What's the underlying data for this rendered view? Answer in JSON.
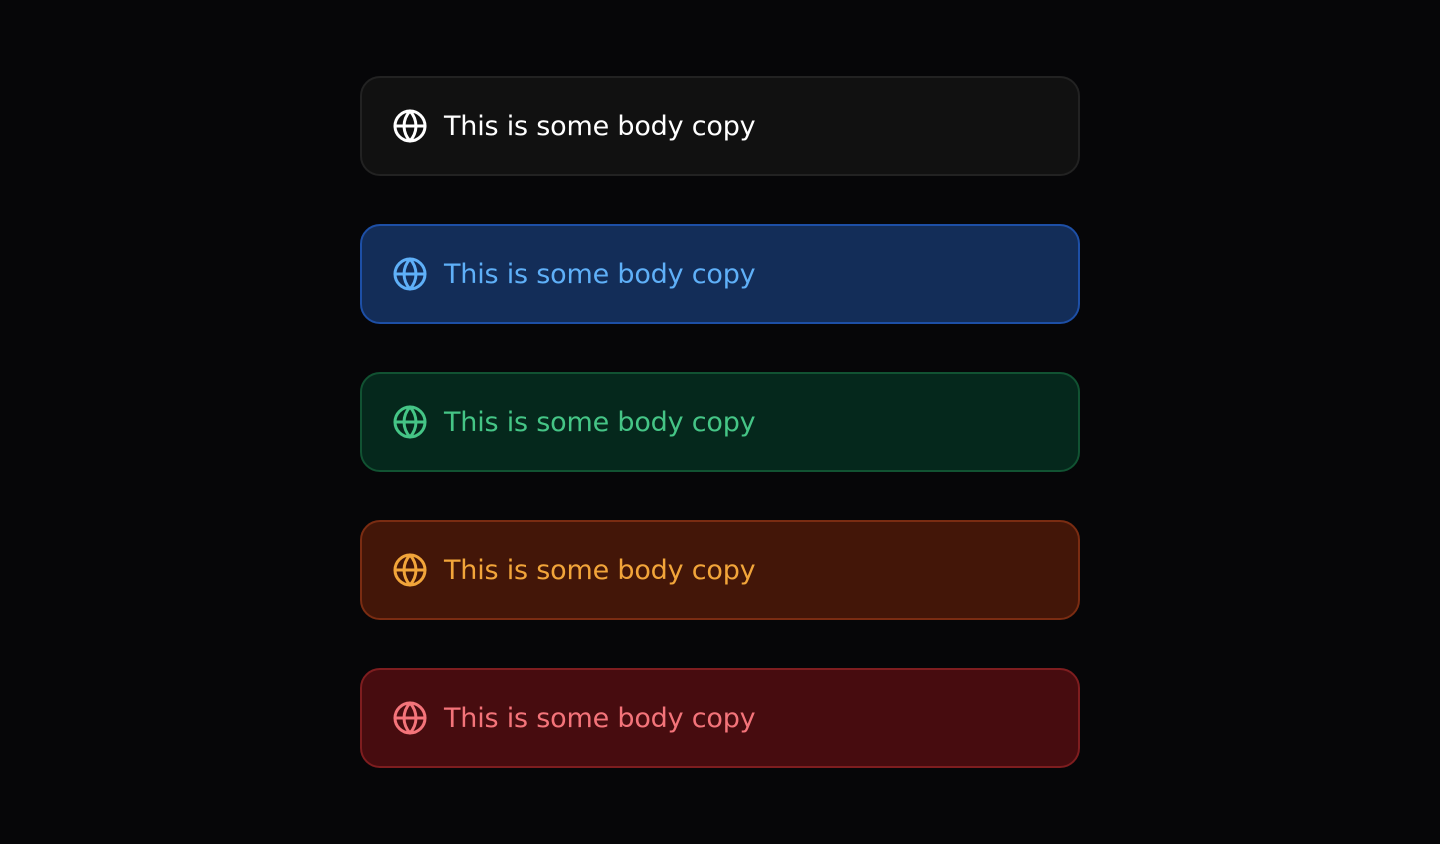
{
  "alerts": [
    {
      "variant": "default",
      "icon": "globe-icon",
      "text": "This is some body copy",
      "colors": {
        "background": "#111111",
        "border": "#222222",
        "foreground": "#ffffff"
      }
    },
    {
      "variant": "info",
      "icon": "globe-icon",
      "text": "This is some body copy",
      "colors": {
        "background": "#132d58",
        "border": "#1d4fa6",
        "foreground": "#5fb0f8"
      }
    },
    {
      "variant": "success",
      "icon": "globe-icon",
      "text": "This is some body copy",
      "colors": {
        "background": "#05281c",
        "border": "#115232",
        "foreground": "#45c586"
      }
    },
    {
      "variant": "warning",
      "icon": "globe-icon",
      "text": "This is some body copy",
      "colors": {
        "background": "#431608",
        "border": "#7a2c12",
        "foreground": "#f2a53a"
      }
    },
    {
      "variant": "error",
      "icon": "globe-icon",
      "text": "This is some body copy",
      "colors": {
        "background": "#470c0f",
        "border": "#7e1d1f",
        "foreground": "#f4747a"
      }
    }
  ]
}
